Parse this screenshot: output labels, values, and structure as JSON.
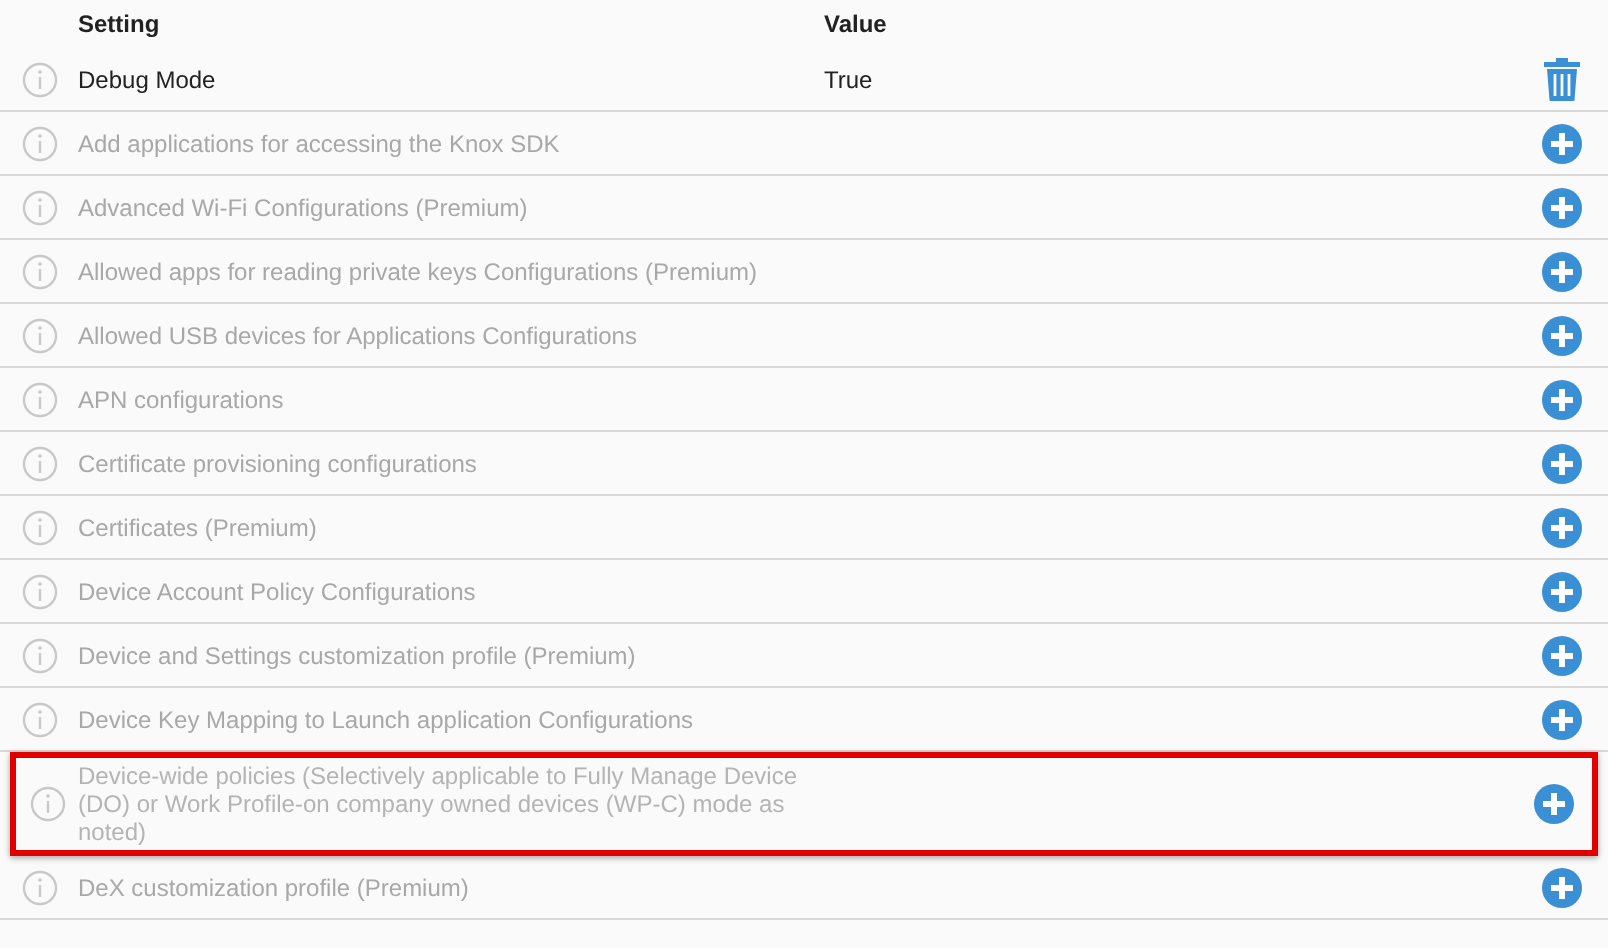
{
  "table": {
    "columns": [
      "Setting",
      "Value"
    ],
    "rows": [
      {
        "setting": "Debug Mode",
        "value": "True",
        "configured": true,
        "highlighted": false
      },
      {
        "setting": "Add applications for accessing the Knox SDK",
        "configured": false,
        "highlighted": false
      },
      {
        "setting": "Advanced Wi-Fi Configurations (Premium)",
        "configured": false,
        "highlighted": false
      },
      {
        "setting": "Allowed apps for reading private keys Configurations (Premium)",
        "configured": false,
        "highlighted": false
      },
      {
        "setting": "Allowed USB devices for Applications Configurations",
        "configured": false,
        "highlighted": false
      },
      {
        "setting": "APN configurations",
        "configured": false,
        "highlighted": false
      },
      {
        "setting": "Certificate provisioning configurations",
        "configured": false,
        "highlighted": false
      },
      {
        "setting": "Certificates (Premium)",
        "configured": false,
        "highlighted": false
      },
      {
        "setting": "Device Account Policy Configurations",
        "configured": false,
        "highlighted": false
      },
      {
        "setting": "Device and Settings customization profile (Premium)",
        "configured": false,
        "highlighted": false
      },
      {
        "setting": "Device Key Mapping to Launch application Configurations",
        "configured": false,
        "highlighted": false
      },
      {
        "setting": "Device-wide policies (Selectively applicable to Fully Manage Device (DO) or Work Profile-on company owned devices (WP-C) mode as noted)",
        "configured": false,
        "highlighted": true
      },
      {
        "setting": "DeX customization profile (Premium)",
        "configured": false,
        "highlighted": false
      }
    ]
  }
}
